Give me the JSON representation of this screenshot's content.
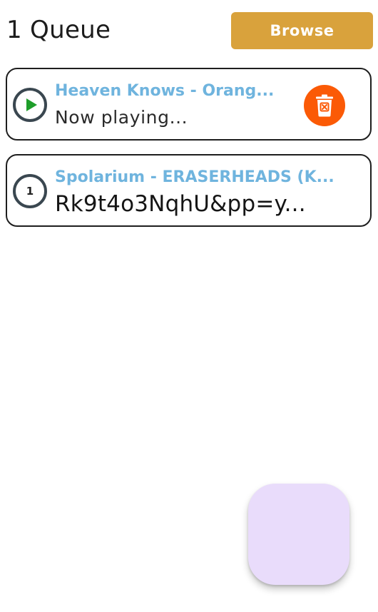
{
  "header": {
    "title": "1 Queue",
    "browse_label": "Browse"
  },
  "queue": [
    {
      "status": "playing",
      "status_icon": "play-icon",
      "title": "Heaven Knows - Orang...",
      "subtitle": "Now playing...",
      "action_icon": "delete-icon"
    },
    {
      "status": "queued",
      "position": "1",
      "title": "Spolarium - ERASERHEADS (K...",
      "subtitle": "Rk9t4o3NqhU&pp=y..."
    }
  ],
  "colors": {
    "accent": "#d9a23c",
    "title_blue": "#6fb4de",
    "play_green": "#1e9e2a",
    "delete_orange": "#fb5a06",
    "fab": "#e9dcfb"
  }
}
